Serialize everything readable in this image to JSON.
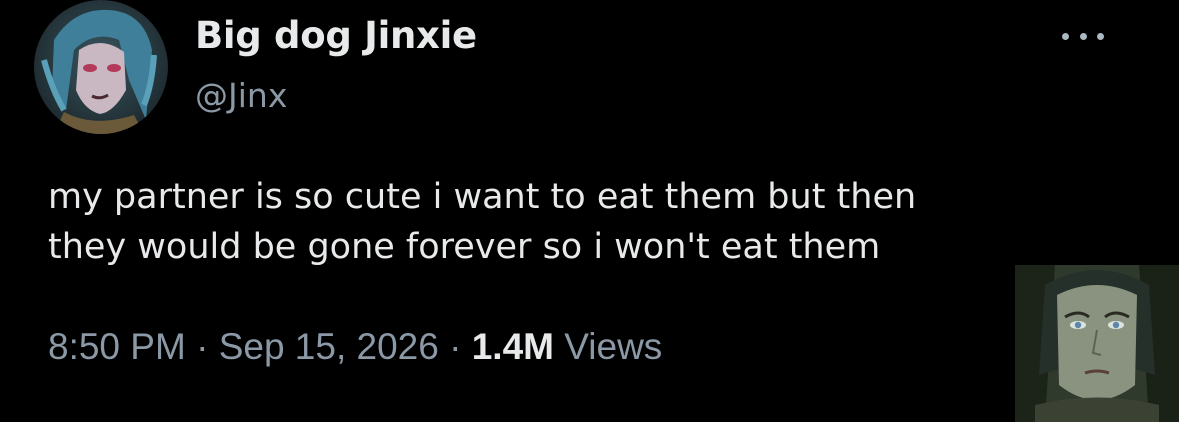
{
  "profile": {
    "display_name": "Big dog Jinxie",
    "handle": "@Jinx",
    "avatar_icon": "profile-avatar-icon"
  },
  "tweet": {
    "text_line1": "my partner is so cute i want to eat them but then",
    "text_line2": "they would be gone forever so i won't eat them",
    "time": "8:50 PM",
    "separator": "·",
    "date": "Sep 15, 2026",
    "views_count": "1.4M",
    "views_label": "Views"
  },
  "colors": {
    "background": "#000000",
    "primary_text": "#e7e9ea",
    "secondary_text": "#8b98a5"
  },
  "icons": {
    "more": "more-options-icon",
    "reaction_image": "reaction-image"
  }
}
